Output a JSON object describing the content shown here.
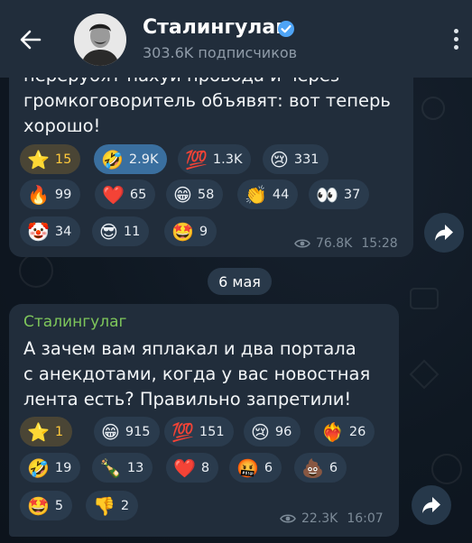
{
  "header": {
    "channel_name": "Сталингулаг",
    "subscribers": "303.6K подписчиков"
  },
  "post1": {
    "text_line1": "перерубят нахуй провода и через",
    "text_line2": "громкоговоритель объявят: вот теперь",
    "text_line3": "хорошо!",
    "reactions": [
      {
        "emoji": "⭐",
        "count": "15"
      },
      {
        "emoji": "🤣",
        "count": "2.9K"
      },
      {
        "emoji": "💯",
        "count": "1.3K"
      },
      {
        "emoji": "😢",
        "count": "331"
      },
      {
        "emoji": "🔥",
        "count": "99"
      },
      {
        "emoji": "❤️",
        "count": "65"
      },
      {
        "emoji": "😁",
        "count": "58"
      },
      {
        "emoji": "👏",
        "count": "44"
      },
      {
        "emoji": "👀",
        "count": "37"
      },
      {
        "emoji": "🤡",
        "count": "34"
      },
      {
        "emoji": "😎",
        "count": "11"
      },
      {
        "emoji": "🤩",
        "count": "9"
      }
    ],
    "views": "76.8K",
    "time": "15:28"
  },
  "date_separator": "6 мая",
  "post2": {
    "sender": "Сталингулаг",
    "text_line1": "А зачем вам яплакал и два портала",
    "text_line2": "с анекдотами, когда у вас новостная",
    "text_line3": "лента есть? Правильно запретили!",
    "reactions": [
      {
        "emoji": "⭐",
        "count": "1"
      },
      {
        "emoji": "😁",
        "count": "915"
      },
      {
        "emoji": "💯",
        "count": "151"
      },
      {
        "emoji": "😢",
        "count": "96"
      },
      {
        "emoji": "❤️‍🔥",
        "count": "26"
      },
      {
        "emoji": "🤣",
        "count": "19"
      },
      {
        "emoji": "🍾",
        "count": "13"
      },
      {
        "emoji": "❤️",
        "count": "8"
      },
      {
        "emoji": "🤬",
        "count": "6"
      },
      {
        "emoji": "💩",
        "count": "6"
      },
      {
        "emoji": "🤩",
        "count": "5"
      },
      {
        "emoji": "👎",
        "count": "2"
      }
    ],
    "views": "22.3K",
    "time": "16:07"
  },
  "colors": {
    "header_bg": "#212d3b",
    "bubble_bg": "#212d3b",
    "accent_blue": "#3a6f9f",
    "sender_green": "#7ec65b",
    "star_gold": "#ffc93b"
  }
}
